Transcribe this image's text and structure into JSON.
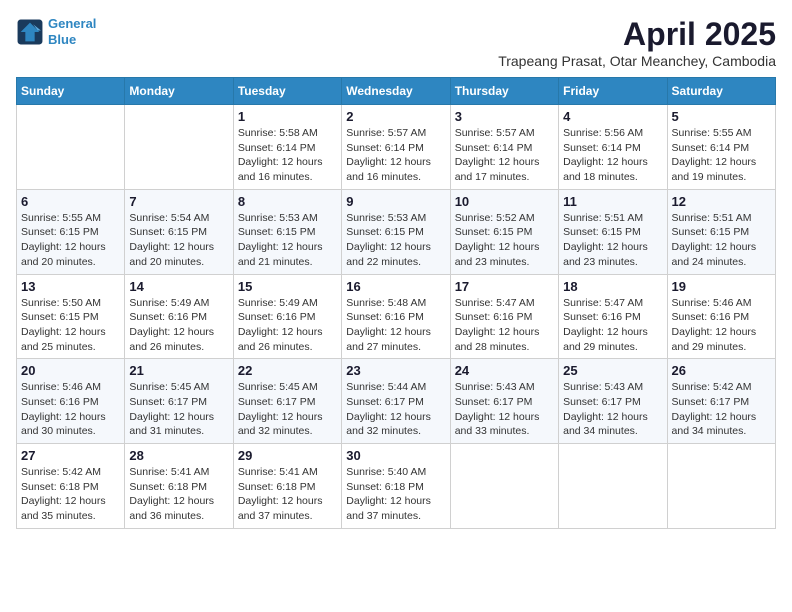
{
  "logo": {
    "line1": "General",
    "line2": "Blue"
  },
  "title": "April 2025",
  "subtitle": "Trapeang Prasat, Otar Meanchey, Cambodia",
  "days_header": [
    "Sunday",
    "Monday",
    "Tuesday",
    "Wednesday",
    "Thursday",
    "Friday",
    "Saturday"
  ],
  "weeks": [
    [
      {
        "day": "",
        "sunrise": "",
        "sunset": "",
        "daylight": ""
      },
      {
        "day": "",
        "sunrise": "",
        "sunset": "",
        "daylight": ""
      },
      {
        "day": "1",
        "sunrise": "Sunrise: 5:58 AM",
        "sunset": "Sunset: 6:14 PM",
        "daylight": "Daylight: 12 hours and 16 minutes."
      },
      {
        "day": "2",
        "sunrise": "Sunrise: 5:57 AM",
        "sunset": "Sunset: 6:14 PM",
        "daylight": "Daylight: 12 hours and 16 minutes."
      },
      {
        "day": "3",
        "sunrise": "Sunrise: 5:57 AM",
        "sunset": "Sunset: 6:14 PM",
        "daylight": "Daylight: 12 hours and 17 minutes."
      },
      {
        "day": "4",
        "sunrise": "Sunrise: 5:56 AM",
        "sunset": "Sunset: 6:14 PM",
        "daylight": "Daylight: 12 hours and 18 minutes."
      },
      {
        "day": "5",
        "sunrise": "Sunrise: 5:55 AM",
        "sunset": "Sunset: 6:14 PM",
        "daylight": "Daylight: 12 hours and 19 minutes."
      }
    ],
    [
      {
        "day": "6",
        "sunrise": "Sunrise: 5:55 AM",
        "sunset": "Sunset: 6:15 PM",
        "daylight": "Daylight: 12 hours and 20 minutes."
      },
      {
        "day": "7",
        "sunrise": "Sunrise: 5:54 AM",
        "sunset": "Sunset: 6:15 PM",
        "daylight": "Daylight: 12 hours and 20 minutes."
      },
      {
        "day": "8",
        "sunrise": "Sunrise: 5:53 AM",
        "sunset": "Sunset: 6:15 PM",
        "daylight": "Daylight: 12 hours and 21 minutes."
      },
      {
        "day": "9",
        "sunrise": "Sunrise: 5:53 AM",
        "sunset": "Sunset: 6:15 PM",
        "daylight": "Daylight: 12 hours and 22 minutes."
      },
      {
        "day": "10",
        "sunrise": "Sunrise: 5:52 AM",
        "sunset": "Sunset: 6:15 PM",
        "daylight": "Daylight: 12 hours and 23 minutes."
      },
      {
        "day": "11",
        "sunrise": "Sunrise: 5:51 AM",
        "sunset": "Sunset: 6:15 PM",
        "daylight": "Daylight: 12 hours and 23 minutes."
      },
      {
        "day": "12",
        "sunrise": "Sunrise: 5:51 AM",
        "sunset": "Sunset: 6:15 PM",
        "daylight": "Daylight: 12 hours and 24 minutes."
      }
    ],
    [
      {
        "day": "13",
        "sunrise": "Sunrise: 5:50 AM",
        "sunset": "Sunset: 6:15 PM",
        "daylight": "Daylight: 12 hours and 25 minutes."
      },
      {
        "day": "14",
        "sunrise": "Sunrise: 5:49 AM",
        "sunset": "Sunset: 6:16 PM",
        "daylight": "Daylight: 12 hours and 26 minutes."
      },
      {
        "day": "15",
        "sunrise": "Sunrise: 5:49 AM",
        "sunset": "Sunset: 6:16 PM",
        "daylight": "Daylight: 12 hours and 26 minutes."
      },
      {
        "day": "16",
        "sunrise": "Sunrise: 5:48 AM",
        "sunset": "Sunset: 6:16 PM",
        "daylight": "Daylight: 12 hours and 27 minutes."
      },
      {
        "day": "17",
        "sunrise": "Sunrise: 5:47 AM",
        "sunset": "Sunset: 6:16 PM",
        "daylight": "Daylight: 12 hours and 28 minutes."
      },
      {
        "day": "18",
        "sunrise": "Sunrise: 5:47 AM",
        "sunset": "Sunset: 6:16 PM",
        "daylight": "Daylight: 12 hours and 29 minutes."
      },
      {
        "day": "19",
        "sunrise": "Sunrise: 5:46 AM",
        "sunset": "Sunset: 6:16 PM",
        "daylight": "Daylight: 12 hours and 29 minutes."
      }
    ],
    [
      {
        "day": "20",
        "sunrise": "Sunrise: 5:46 AM",
        "sunset": "Sunset: 6:16 PM",
        "daylight": "Daylight: 12 hours and 30 minutes."
      },
      {
        "day": "21",
        "sunrise": "Sunrise: 5:45 AM",
        "sunset": "Sunset: 6:17 PM",
        "daylight": "Daylight: 12 hours and 31 minutes."
      },
      {
        "day": "22",
        "sunrise": "Sunrise: 5:45 AM",
        "sunset": "Sunset: 6:17 PM",
        "daylight": "Daylight: 12 hours and 32 minutes."
      },
      {
        "day": "23",
        "sunrise": "Sunrise: 5:44 AM",
        "sunset": "Sunset: 6:17 PM",
        "daylight": "Daylight: 12 hours and 32 minutes."
      },
      {
        "day": "24",
        "sunrise": "Sunrise: 5:43 AM",
        "sunset": "Sunset: 6:17 PM",
        "daylight": "Daylight: 12 hours and 33 minutes."
      },
      {
        "day": "25",
        "sunrise": "Sunrise: 5:43 AM",
        "sunset": "Sunset: 6:17 PM",
        "daylight": "Daylight: 12 hours and 34 minutes."
      },
      {
        "day": "26",
        "sunrise": "Sunrise: 5:42 AM",
        "sunset": "Sunset: 6:17 PM",
        "daylight": "Daylight: 12 hours and 34 minutes."
      }
    ],
    [
      {
        "day": "27",
        "sunrise": "Sunrise: 5:42 AM",
        "sunset": "Sunset: 6:18 PM",
        "daylight": "Daylight: 12 hours and 35 minutes."
      },
      {
        "day": "28",
        "sunrise": "Sunrise: 5:41 AM",
        "sunset": "Sunset: 6:18 PM",
        "daylight": "Daylight: 12 hours and 36 minutes."
      },
      {
        "day": "29",
        "sunrise": "Sunrise: 5:41 AM",
        "sunset": "Sunset: 6:18 PM",
        "daylight": "Daylight: 12 hours and 37 minutes."
      },
      {
        "day": "30",
        "sunrise": "Sunrise: 5:40 AM",
        "sunset": "Sunset: 6:18 PM",
        "daylight": "Daylight: 12 hours and 37 minutes."
      },
      {
        "day": "",
        "sunrise": "",
        "sunset": "",
        "daylight": ""
      },
      {
        "day": "",
        "sunrise": "",
        "sunset": "",
        "daylight": ""
      },
      {
        "day": "",
        "sunrise": "",
        "sunset": "",
        "daylight": ""
      }
    ]
  ]
}
